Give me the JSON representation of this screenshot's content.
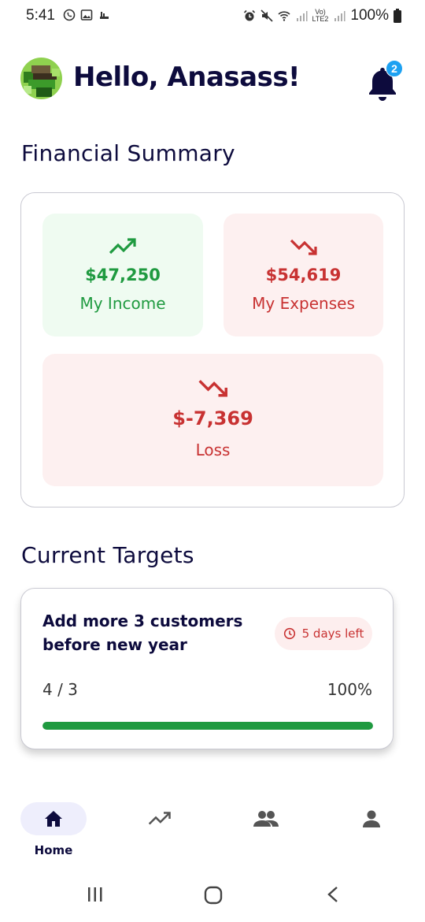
{
  "status_bar": {
    "time": "5:41",
    "battery": "100%",
    "network_top": "Vo)",
    "network_bottom": "LTE2",
    "left_icons": [
      "whatsapp-icon",
      "gallery-icon",
      "notification-icon"
    ],
    "right_icons": [
      "alarm-icon",
      "mute-icon",
      "wifi-icon",
      "signal-icon",
      "battery-icon"
    ]
  },
  "header": {
    "greeting": "Hello, Anasass!",
    "notification_count": "2"
  },
  "financial_summary": {
    "title": "Financial Summary",
    "income": {
      "amount": "$47,250",
      "label": "My Income",
      "icon": "trending-up-icon",
      "color": "#1f9a40"
    },
    "expenses": {
      "amount": "$54,619",
      "label": "My Expenses",
      "icon": "trending-down-icon",
      "color": "#c83232"
    },
    "net": {
      "amount": "$-7,369",
      "label": "Loss",
      "icon": "trending-down-icon",
      "color": "#c83232"
    }
  },
  "current_targets": {
    "title": "Current Targets",
    "items": [
      {
        "title": "Add more 3 customers before new year",
        "deadline": "5 days left",
        "progress_count": "4 / 3",
        "progress_percent": "100%",
        "progress_fraction": 1.0
      }
    ]
  },
  "bottom_nav": {
    "items": [
      {
        "label": "Home",
        "icon": "home-icon",
        "active": true
      },
      {
        "label": "",
        "icon": "trending-up-icon",
        "active": false
      },
      {
        "label": "",
        "icon": "group-icon",
        "active": false
      },
      {
        "label": "",
        "icon": "person-icon",
        "active": false
      }
    ]
  },
  "colors": {
    "primary_text": "#0d0b3d",
    "income_green": "#1f9a40",
    "expense_red": "#c83232",
    "badge_blue": "#1da1f2"
  }
}
